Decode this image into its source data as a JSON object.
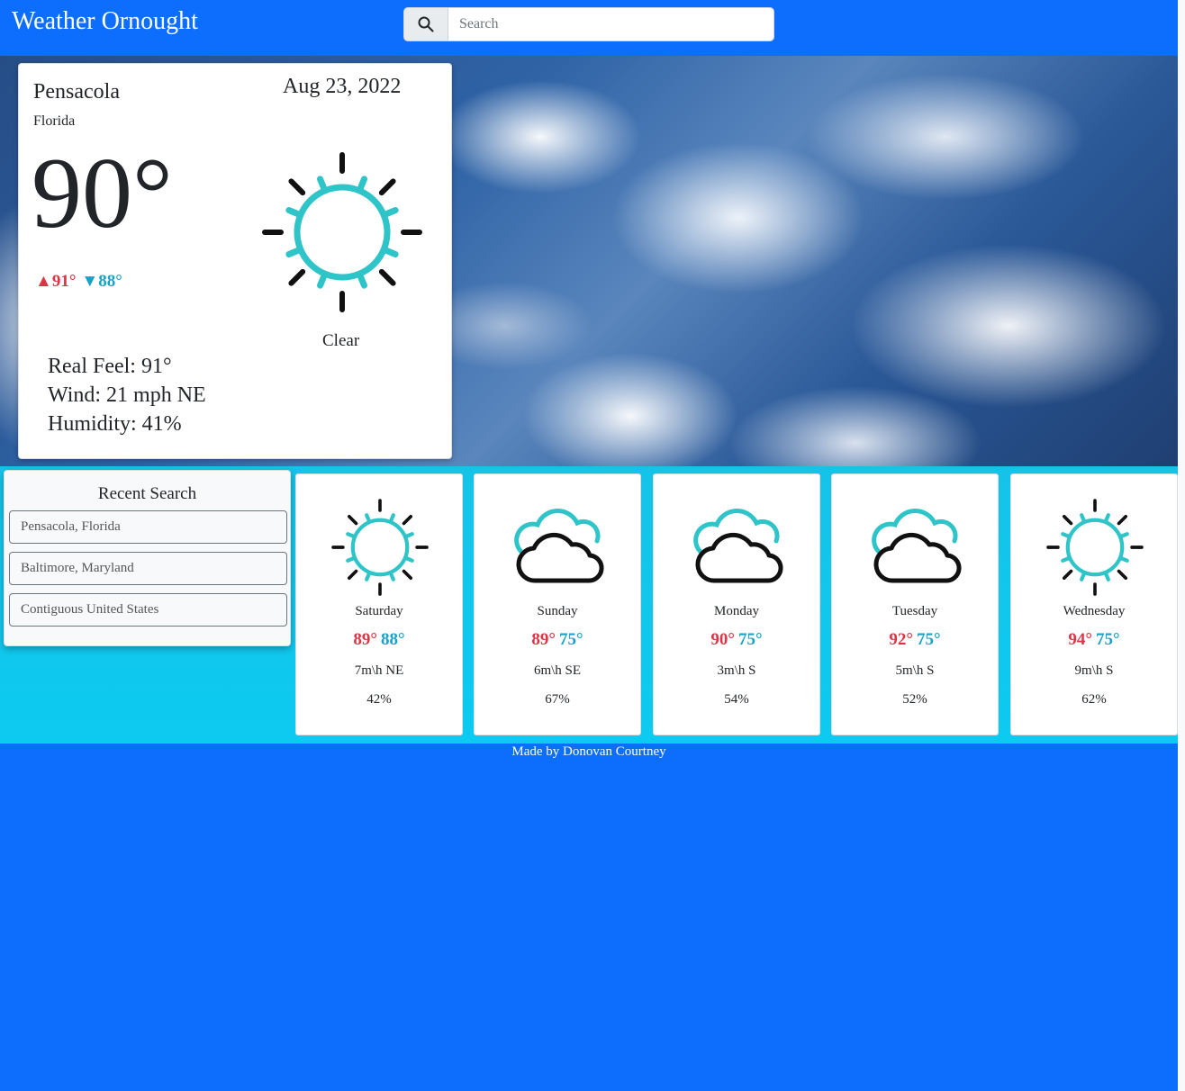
{
  "app": {
    "title": "Weather Ornought"
  },
  "search": {
    "placeholder": "Search",
    "value": ""
  },
  "current": {
    "city": "Pensacola",
    "state": "Florida",
    "date": "Aug 23, 2022",
    "temp": "90°",
    "high": "91°",
    "low": "88°",
    "condition": "Clear",
    "icon": "sun-icon",
    "real_feel": "Real Feel: 91°",
    "wind": "Wind: 21 mph NE",
    "humidity": "Humidity: 41%"
  },
  "recent": {
    "title": "Recent Search",
    "items": [
      "Pensacola, Florida",
      "Baltimore, Maryland",
      "Contiguous United States"
    ]
  },
  "forecast": [
    {
      "day": "Saturday",
      "high": "89°",
      "low": "88°",
      "wind": "7m\\h NE",
      "humidity": "42%",
      "icon": "sun-icon"
    },
    {
      "day": "Sunday",
      "high": "89°",
      "low": "75°",
      "wind": "6m\\h SE",
      "humidity": "67%",
      "icon": "cloud-icon"
    },
    {
      "day": "Monday",
      "high": "90°",
      "low": "75°",
      "wind": "3m\\h S",
      "humidity": "54%",
      "icon": "cloud-icon"
    },
    {
      "day": "Tuesday",
      "high": "92°",
      "low": "75°",
      "wind": "5m\\h S",
      "humidity": "52%",
      "icon": "cloud-icon"
    },
    {
      "day": "Wednesday",
      "high": "94°",
      "low": "75°",
      "wind": "9m\\h S",
      "humidity": "62%",
      "icon": "sun-icon"
    }
  ],
  "footer": {
    "text": "Made by Donovan Courtney"
  },
  "colors": {
    "primary": "#0d6efd",
    "band": "#0dcaf0",
    "high": "#dc3545",
    "low": "#17a2c8",
    "icon_accent": "#2ec4c8"
  }
}
